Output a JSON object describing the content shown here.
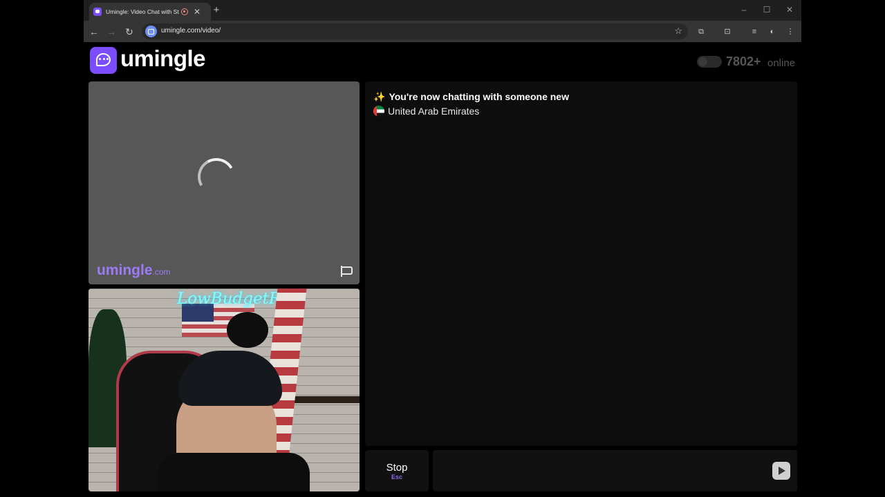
{
  "browser": {
    "tab_title": "Umingle: Video Chat with Strangers",
    "url": "umingle.com/video/",
    "window_controls": [
      "minimize-icon",
      "maximize-icon",
      "close-icon"
    ]
  },
  "header": {
    "logo_text": "umingle",
    "online_count": "7802+",
    "online_label": "online"
  },
  "stranger_video": {
    "watermark": "umingle",
    "watermark_suffix": ".com",
    "loading": true
  },
  "self_video": {
    "neon_sign": "LowBudgetRS"
  },
  "chat": {
    "system_message": "You're now chatting with someone new",
    "sparkle": "✨",
    "country": "United Arab Emirates"
  },
  "controls": {
    "stop_label": "Stop",
    "stop_key": "Esc",
    "message_placeholder": ""
  },
  "colors": {
    "brand": "#7c4dff",
    "watermark": "#9d7bf5"
  }
}
